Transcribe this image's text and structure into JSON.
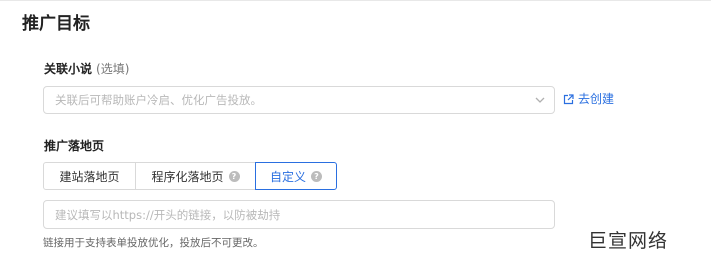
{
  "section": {
    "title": "推广目标"
  },
  "novel": {
    "label": "关联小说",
    "optional": "(选填)",
    "placeholder": "关联后可帮助账户冷启、优化广告投放。",
    "chevron_icon": "chevron-down-icon",
    "create_link": "去创建",
    "create_icon": "external-link-icon"
  },
  "landing": {
    "label": "推广落地页",
    "tabs": [
      {
        "label": "建站落地页",
        "selected": false,
        "has_help": false
      },
      {
        "label": "程序化落地页",
        "selected": false,
        "has_help": true
      },
      {
        "label": "自定义",
        "selected": true,
        "has_help": true
      }
    ],
    "help_glyph": "?",
    "url_placeholder": "建议填写以https://开头的链接，以防被劫持",
    "hint": "链接用于支持表单投放优化，投放后不可更改。"
  },
  "watermark": "巨宣网络",
  "colors": {
    "accent": "#2a6fe0",
    "border": "#d9d9d9",
    "placeholder": "#b8b8b8",
    "help_icon_bg": "#bcbcbc"
  }
}
